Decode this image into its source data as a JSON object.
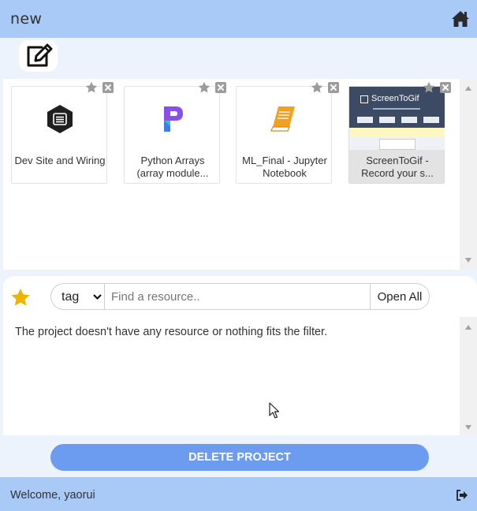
{
  "header": {
    "title": "new",
    "home_icon": "home-icon"
  },
  "toolbar": {
    "edit_icon": "edit-icon"
  },
  "resources": [
    {
      "label": "Dev Site and Wiring",
      "icon": "app-hexagon-icon"
    },
    {
      "label": "Python Arrays (array module...",
      "icon": "pycharm-logo-icon"
    },
    {
      "label": "ML_Final - Jupyter Notebook",
      "icon": "notebook-icon"
    },
    {
      "label": "ScreenToGif - Record your s...",
      "icon": "screentogif-thumbnail",
      "thumbnail_title": "ScreenToGif"
    }
  ],
  "filter": {
    "tag_value": "tag",
    "search_placeholder": "Find a resource..",
    "open_all_label": "Open All",
    "favorite_color": "#f0b400"
  },
  "results": {
    "empty_message": "The project doesn't have any resource or nothing fits the filter."
  },
  "actions": {
    "delete_label": "DELETE PROJECT",
    "delete_color": "#6b9cef"
  },
  "footer": {
    "welcome_text": "Welcome, yaorui",
    "logout_icon": "logout-icon"
  },
  "colors": {
    "header_bg": "#a9c9f6",
    "page_bg": "#ecf3fd",
    "accent": "#6b9cef"
  }
}
